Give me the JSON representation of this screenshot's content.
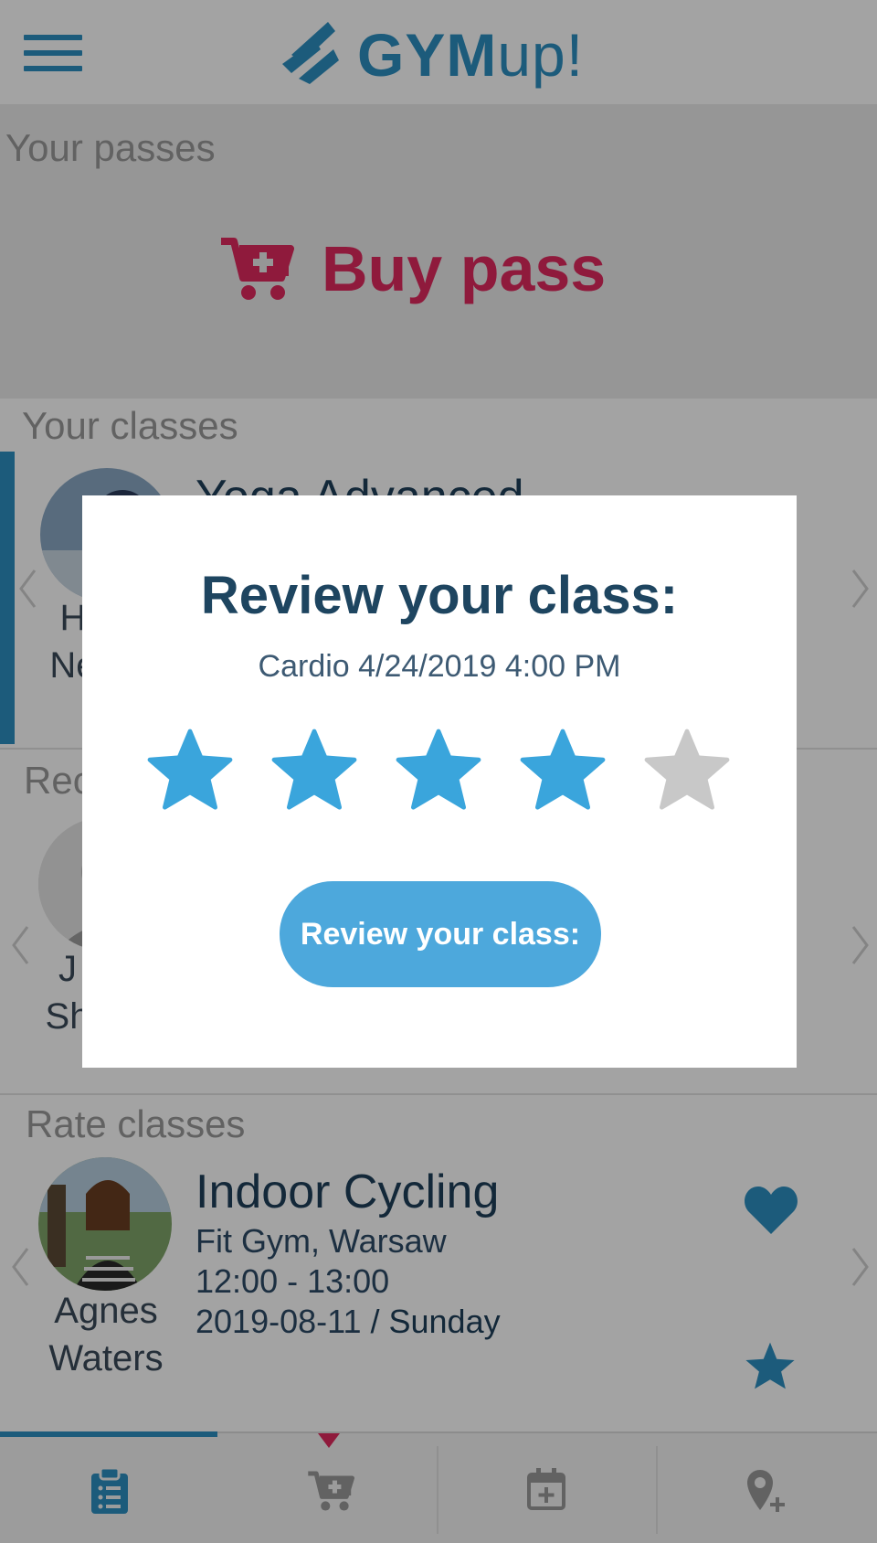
{
  "header": {
    "logo_text_bold": "GYM",
    "logo_text_light": "up!"
  },
  "passes": {
    "title": "Your passes",
    "buy_label": "Buy pass"
  },
  "classes": {
    "title": "Your classes",
    "item": {
      "class_name": "Yoga Advanced",
      "trainer_line1": "H",
      "trainer_line2": "Ne"
    }
  },
  "recommended": {
    "title": "Rec",
    "item": {
      "trainer_line1": "J",
      "trainer_line2": "Sh"
    }
  },
  "rate": {
    "title": "Rate classes",
    "item": {
      "class_name": "Indoor Cycling",
      "location": "Fit Gym, Warsaw",
      "time": "12:00 - 13:00",
      "date": "2019-08-11",
      "separator": " / ",
      "weekday": "Sunday",
      "trainer_line1": "Agnes",
      "trainer_line2": "Waters"
    }
  },
  "modal": {
    "title": "Review your class:",
    "subtitle": "Cardio 4/24/2019 4:00 PM",
    "rating": 4,
    "max_rating": 5,
    "button_label": "Review your class:"
  },
  "colors": {
    "brand": "#2c8fc0",
    "accent_pink": "#e02a5e",
    "star_active": "#3aa5dc",
    "star_inactive": "#c8c8c8",
    "button": "#4da8dc"
  },
  "bottom_nav": {
    "items": [
      {
        "icon": "clipboard-list-icon",
        "active": true
      },
      {
        "icon": "cart-plus-icon",
        "active": false
      },
      {
        "icon": "calendar-plus-icon",
        "active": false
      },
      {
        "icon": "map-marker-plus-icon",
        "active": false
      }
    ]
  }
}
